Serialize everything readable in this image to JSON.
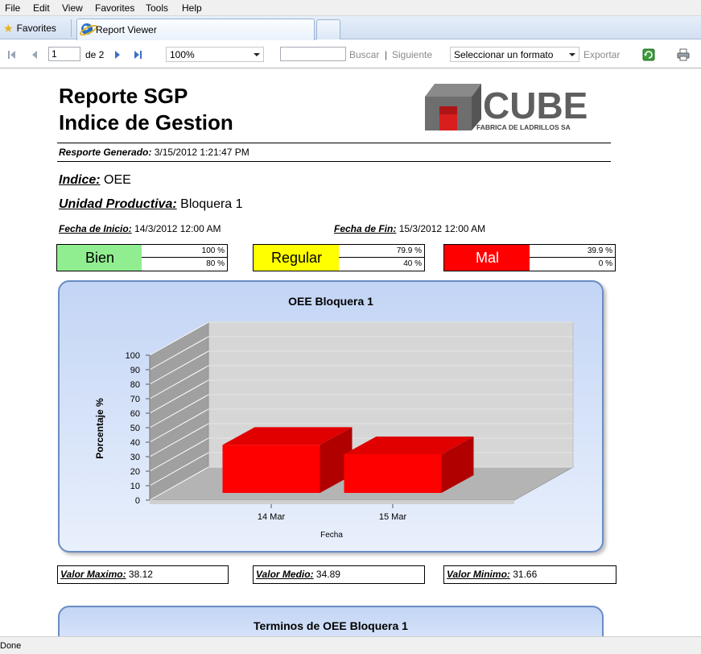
{
  "menu": [
    "File",
    "Edit",
    "View",
    "Favorites",
    "Tools",
    "Help"
  ],
  "tabs": {
    "favorites_label": "Favorites",
    "active_tab_title": "Report Viewer"
  },
  "toolbar": {
    "page_value": "1",
    "page_of": "de 2",
    "zoom": "100%",
    "search_value": "",
    "find_label": "Buscar",
    "separator": "|",
    "next_label": "Siguiente",
    "format_select": "Seleccionar un formato",
    "export_label": "Exportar"
  },
  "report": {
    "title_line1": "Reporte SGP",
    "title_line2": "Indice de Gestion",
    "logo": {
      "brand": "CUBE",
      "tagline": "FABRICA DE LADRILLOS SA"
    },
    "generated_label": "Resporte Generado:",
    "generated_value": "3/15/2012 1:21:47 PM",
    "indice_label": "Indice:",
    "indice_value": "OEE",
    "unidad_label": "Unidad Productiva:",
    "unidad_value": "Bloquera 1",
    "fecha_inicio_label": "Fecha de Inicio:",
    "fecha_inicio_value": "14/3/2012 12:00 AM",
    "fecha_fin_label": "Fecha de Fin:",
    "fecha_fin_value": "15/3/2012 12:00 AM",
    "thresholds": [
      {
        "name": "Bien",
        "high": "100 %",
        "low": "80 %",
        "color": "#90ee90",
        "text_color": "#000000"
      },
      {
        "name": "Regular",
        "high": "79.9 %",
        "low": "40 %",
        "color": "#ffff00",
        "text_color": "#000000"
      },
      {
        "name": "Mal",
        "high": "39.9 %",
        "low": "0 %",
        "color": "#ff0000",
        "text_color": "#ffffff"
      }
    ],
    "stats": {
      "max_label": "Valor Maximo:",
      "max_value": "38.12",
      "mean_label": "Valor Medio:",
      "mean_value": "34.89",
      "min_label": "Valor Minimo:",
      "min_value": "31.66"
    },
    "second_panel_title": "Terminos de OEE Bloquera 1"
  },
  "chart_data": {
    "type": "bar",
    "title": "OEE Bloquera 1",
    "xlabel": "Fecha",
    "ylabel": "Porcentaje %",
    "categories": [
      "14 Mar",
      "15 Mar"
    ],
    "values": [
      38.12,
      31.66
    ],
    "ylim": [
      0,
      100
    ],
    "yticks": [
      "0",
      "10",
      "20",
      "30",
      "40",
      "50",
      "60",
      "70",
      "80",
      "90",
      "100"
    ],
    "bar_color": "#ff0000",
    "three_d": true,
    "grid": true
  },
  "status": {
    "text": "Done"
  }
}
